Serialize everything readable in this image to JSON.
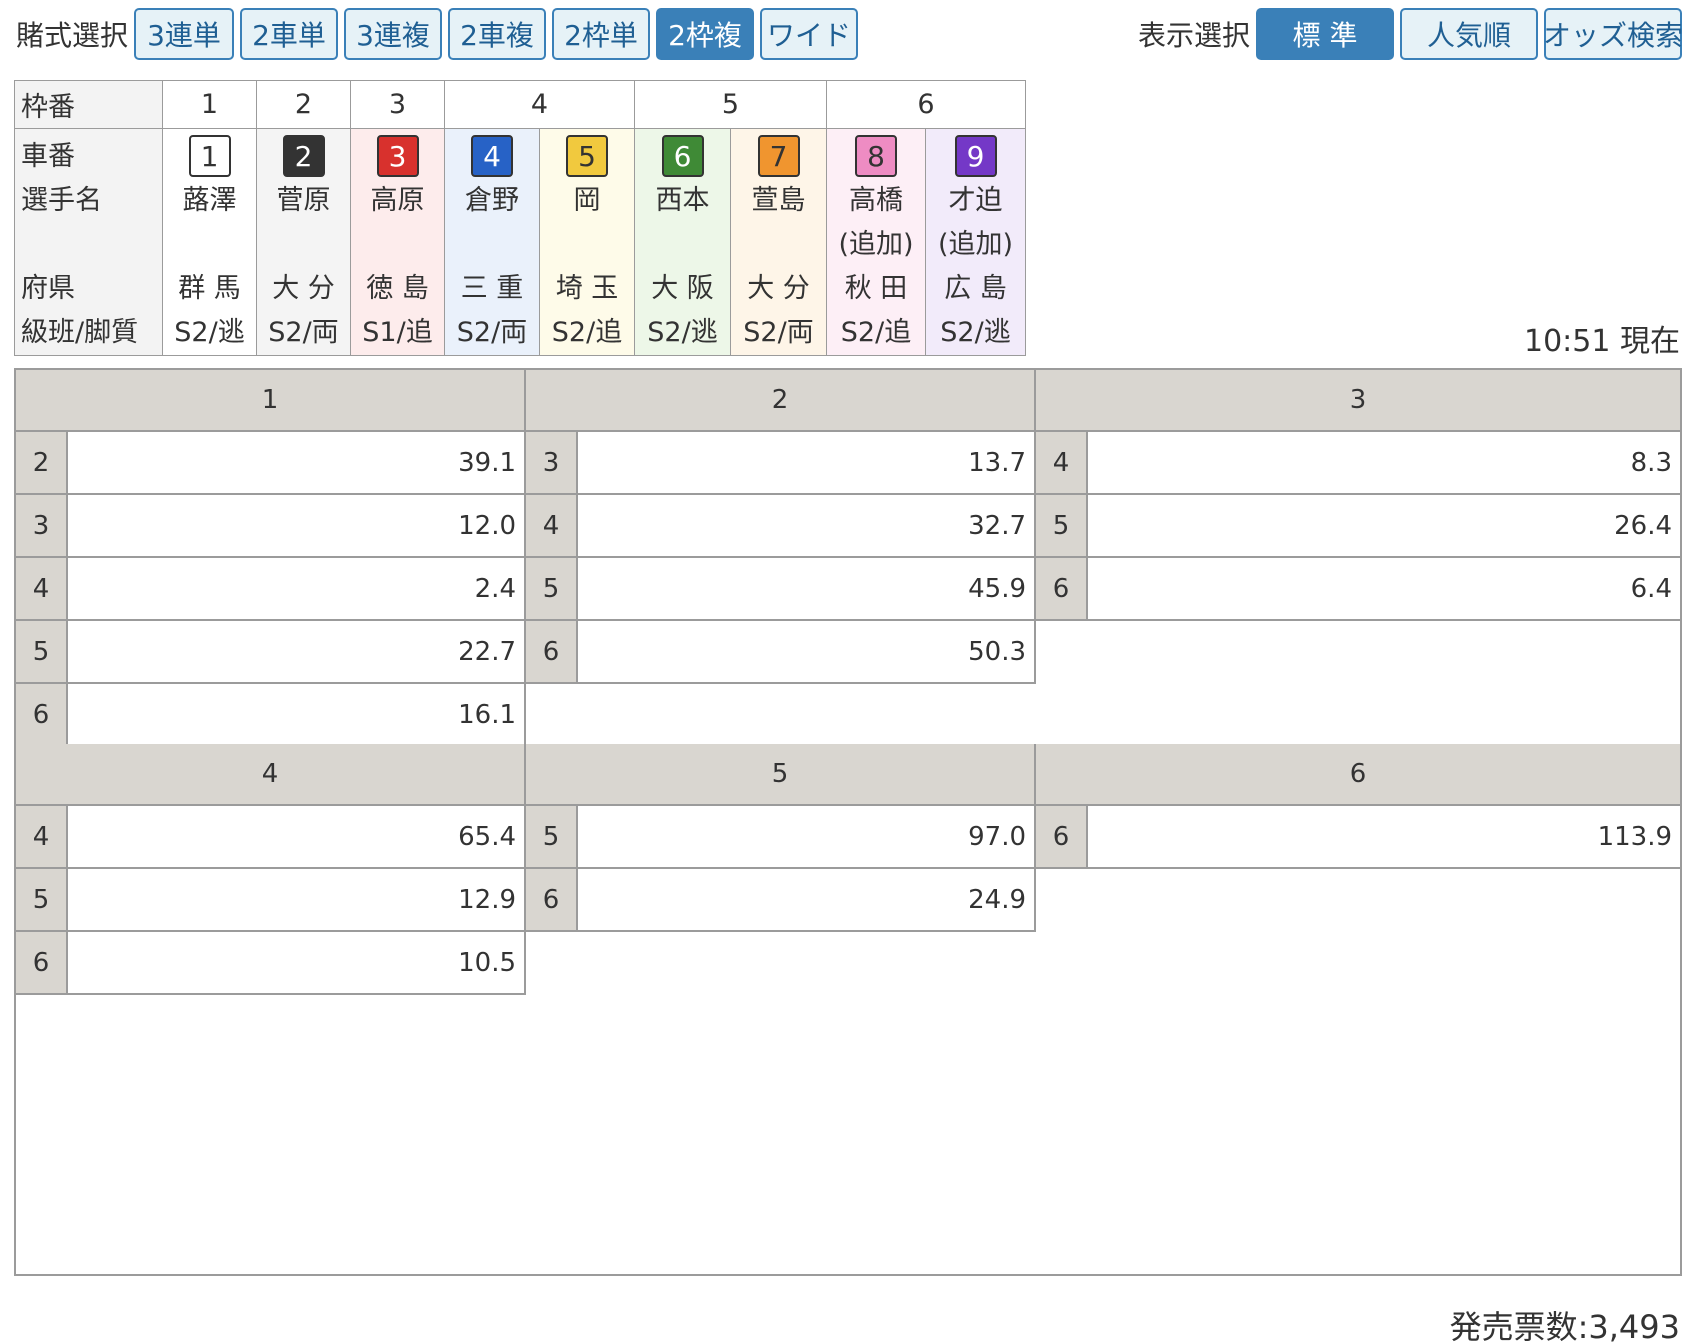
{
  "bet_select": {
    "label": "賭式選択",
    "buttons": [
      "3連単",
      "2車単",
      "3連複",
      "2車複",
      "2枠単",
      "2枠複",
      "ワイド"
    ],
    "active": "2枠複"
  },
  "view_select": {
    "label": "表示選択",
    "buttons": [
      "標 準",
      "人気順",
      "オッズ検索"
    ],
    "active": "標 準"
  },
  "entry": {
    "headers": {
      "frame": "枠番",
      "car": "車番",
      "name": "選手名",
      "pref": "府県",
      "class": "級班/脚質"
    },
    "frames": [
      {
        "label": "1",
        "span": 1
      },
      {
        "label": "2",
        "span": 1
      },
      {
        "label": "3",
        "span": 1
      },
      {
        "label": "4",
        "span": 2
      },
      {
        "label": "5",
        "span": 2
      },
      {
        "label": "6",
        "span": 2
      }
    ],
    "riders": [
      {
        "car": "1",
        "name": "蕗澤",
        "note": "",
        "pref": "群 馬",
        "class": "S2/逃"
      },
      {
        "car": "2",
        "name": "菅原",
        "note": "",
        "pref": "大 分",
        "class": "S2/両"
      },
      {
        "car": "3",
        "name": "高原",
        "note": "",
        "pref": "徳 島",
        "class": "S1/追"
      },
      {
        "car": "4",
        "name": "倉野",
        "note": "",
        "pref": "三 重",
        "class": "S2/両"
      },
      {
        "car": "5",
        "name": "岡",
        "note": "",
        "pref": "埼 玉",
        "class": "S2/追"
      },
      {
        "car": "6",
        "name": "西本",
        "note": "",
        "pref": "大 阪",
        "class": "S2/逃"
      },
      {
        "car": "7",
        "name": "萱島",
        "note": "",
        "pref": "大 分",
        "class": "S2/両"
      },
      {
        "car": "8",
        "name": "高橋",
        "note": "(追加)",
        "pref": "秋 田",
        "class": "S2/追"
      },
      {
        "car": "9",
        "name": "才迫",
        "note": "(追加)",
        "pref": "広 島",
        "class": "S2/逃"
      }
    ]
  },
  "now_time": "10:51 現在",
  "odds": {
    "blocks": [
      {
        "head": "1",
        "rows": [
          [
            "2",
            "39.1"
          ],
          [
            "3",
            "12.0"
          ],
          [
            "4",
            "2.4"
          ],
          [
            "5",
            "22.7"
          ],
          [
            "6",
            "16.1"
          ]
        ]
      },
      {
        "head": "2",
        "rows": [
          [
            "3",
            "13.7"
          ],
          [
            "4",
            "32.7"
          ],
          [
            "5",
            "45.9"
          ],
          [
            "6",
            "50.3"
          ]
        ]
      },
      {
        "head": "3",
        "rows": [
          [
            "4",
            "8.3"
          ],
          [
            "5",
            "26.4"
          ],
          [
            "6",
            "6.4"
          ]
        ]
      },
      {
        "head": "4",
        "rows": [
          [
            "4",
            "65.4"
          ],
          [
            "5",
            "12.9"
          ],
          [
            "6",
            "10.5"
          ]
        ]
      },
      {
        "head": "5",
        "rows": [
          [
            "5",
            "97.0"
          ],
          [
            "6",
            "24.9"
          ]
        ]
      },
      {
        "head": "6",
        "rows": [
          [
            "6",
            "113.9"
          ]
        ]
      }
    ]
  },
  "sales": "発売票数:3,493"
}
